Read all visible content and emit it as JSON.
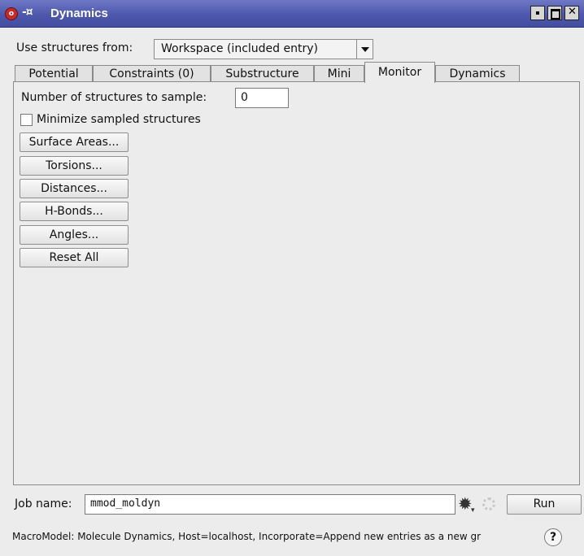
{
  "window": {
    "title": "Dynamics"
  },
  "structures": {
    "label": "Use structures from:",
    "value": "Workspace (included entry)"
  },
  "tabs": [
    {
      "label": "Potential"
    },
    {
      "label": "Constraints (0)"
    },
    {
      "label": "Substructure"
    },
    {
      "label": "Mini"
    },
    {
      "label": "Monitor",
      "active": true
    },
    {
      "label": "Dynamics"
    }
  ],
  "monitor": {
    "num_label": "Number of structures to sample:",
    "num_value": "0",
    "minimize_label": "Minimize sampled structures",
    "minimize_checked": false,
    "buttons": [
      "Surface Areas...",
      "Torsions...",
      "Distances...",
      "H-Bonds...",
      "Angles...",
      "Reset All"
    ]
  },
  "footer": {
    "job_label": "Job name:",
    "job_value": "mmod_moldyn",
    "run_label": "Run",
    "status": "MacroModel: Molecule Dynamics, Host=localhost, Incorporate=Append new entries as a new gr",
    "help": "?"
  },
  "icons": [
    "app-icon",
    "pin-icon",
    "gear-icon",
    "spinner-icon",
    "help-icon"
  ],
  "colors": {
    "titlebar": "#4d58ad",
    "background": "#ececec"
  }
}
